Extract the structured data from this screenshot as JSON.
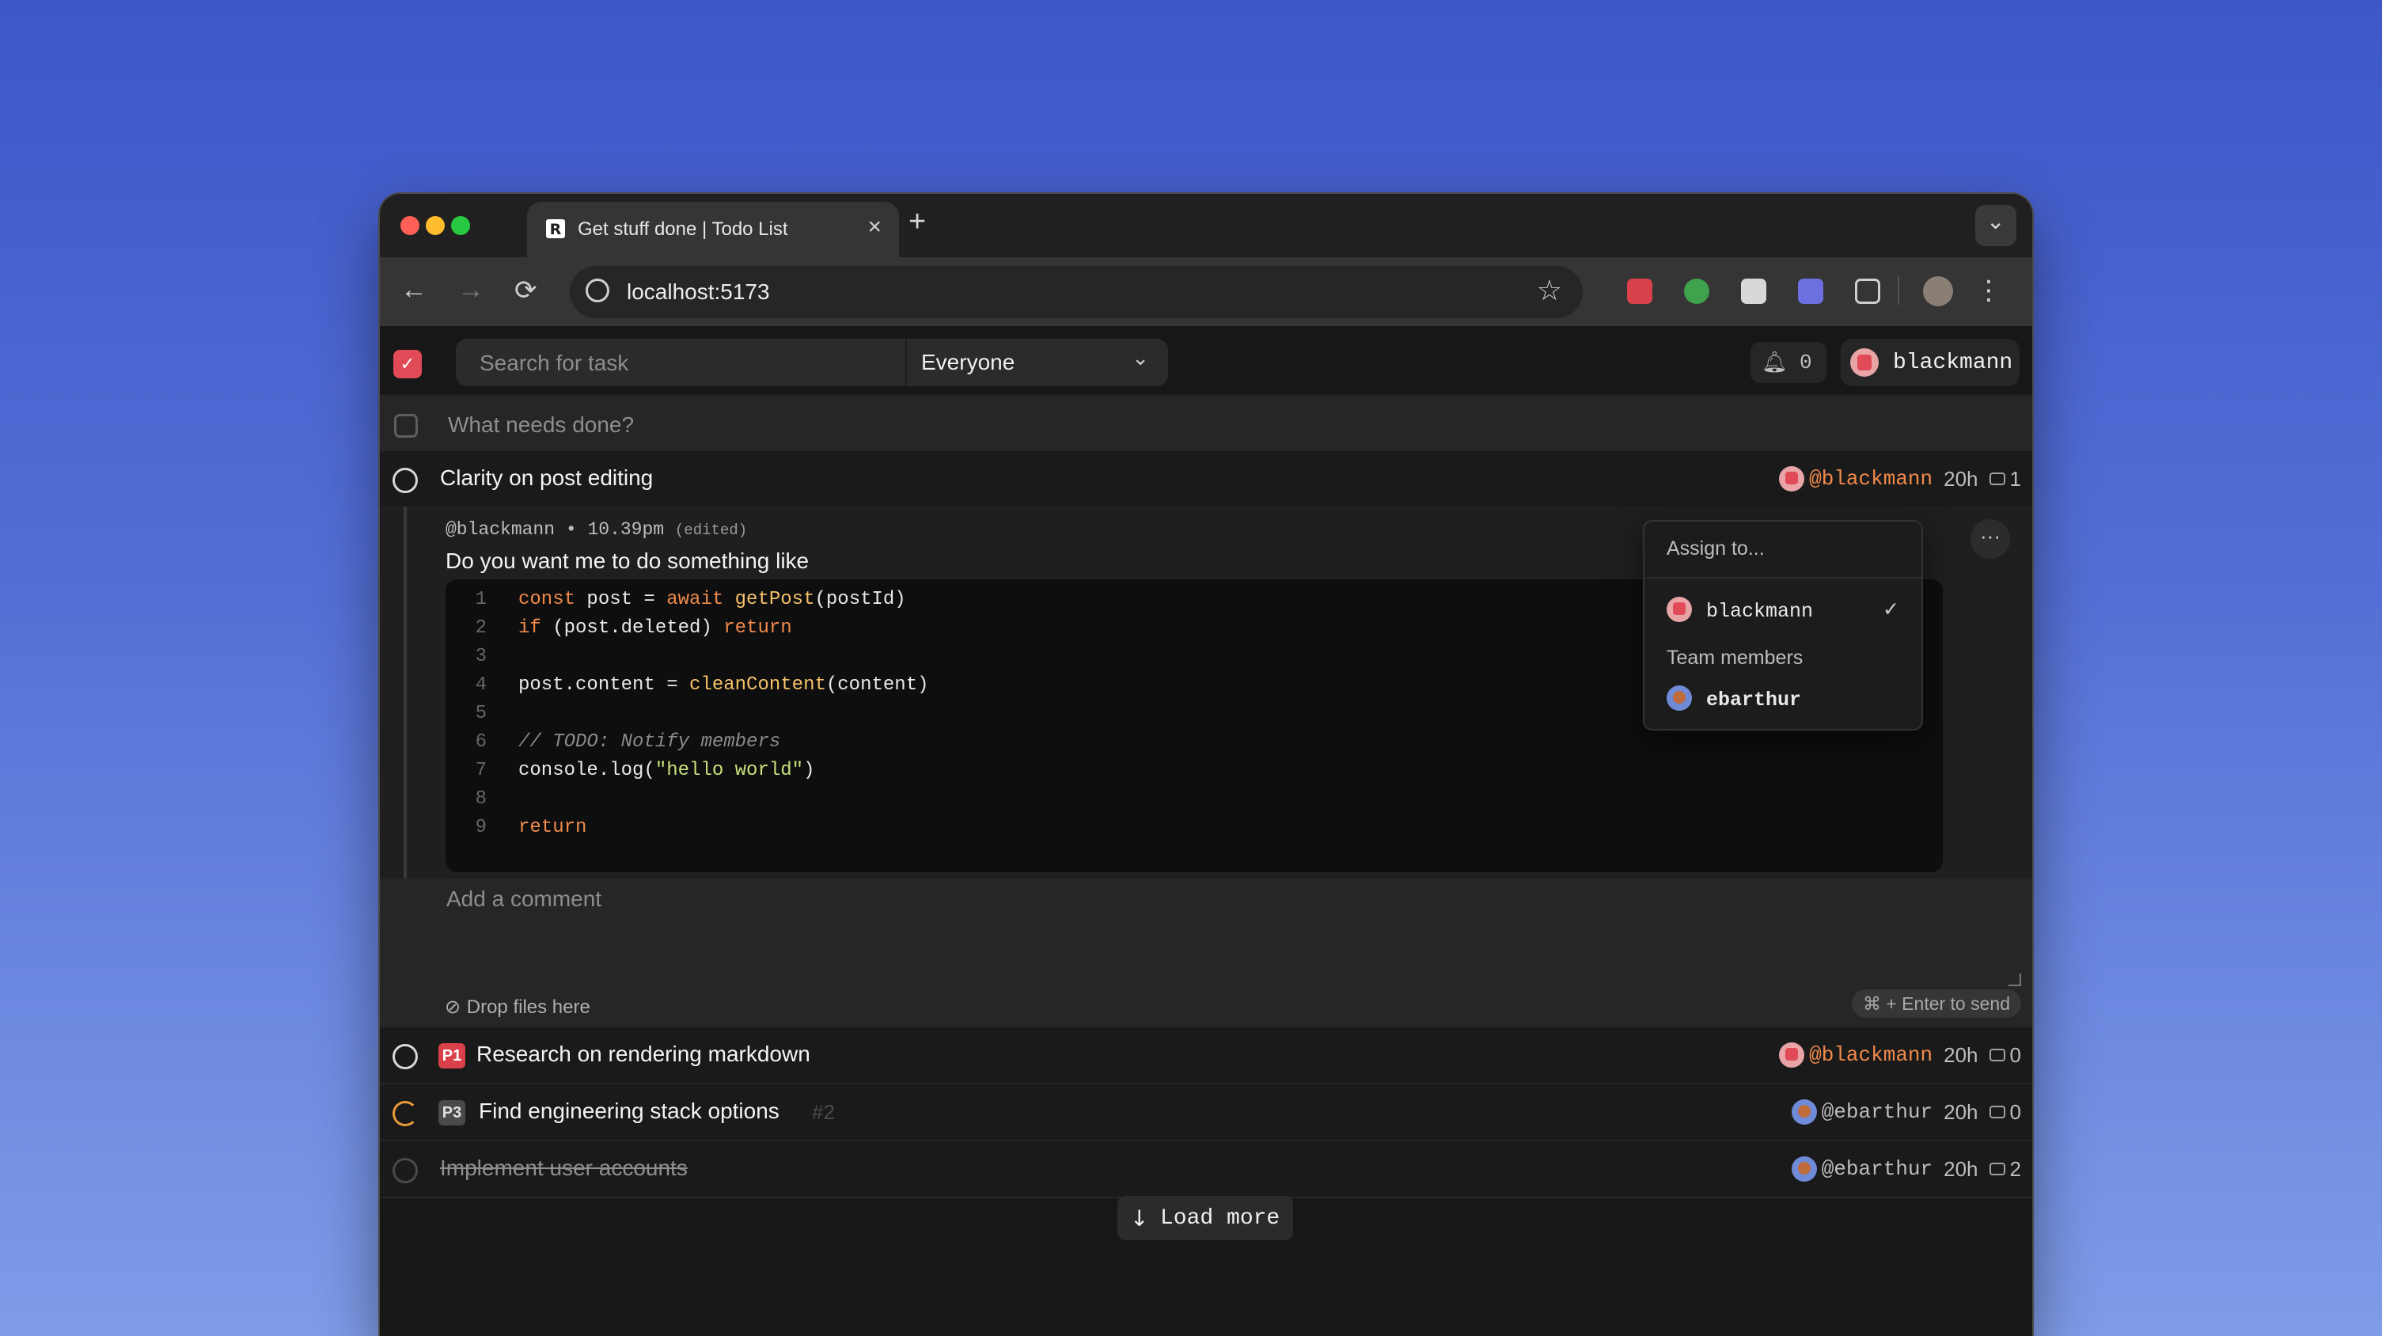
{
  "browser": {
    "tab_title": "Get stuff done | Todo List",
    "tab_close": "×",
    "new_tab": "+",
    "url": "localhost:5173",
    "back": "←",
    "forward": "→",
    "reload": "⟳",
    "bookmark": "☆",
    "menu": "⋮",
    "tab_menu": "⌄"
  },
  "app": {
    "search_placeholder": "Search for task",
    "filter_value": "Everyone",
    "filter_chevron": "⌄",
    "notification_count": "0",
    "current_user": "blackmann",
    "new_task_placeholder": "What needs done?",
    "load_more": "Load more",
    "load_more_arrow": "↓"
  },
  "tasks": [
    {
      "title": "Clarity on post editing",
      "assignee": "@blackmann",
      "time": "20h",
      "comments": "1",
      "status": "open",
      "priority": ""
    },
    {
      "title": "Research on rendering markdown",
      "assignee": "@blackmann",
      "time": "20h",
      "comments": "0",
      "status": "open",
      "priority": "P1"
    },
    {
      "title": "Find engineering stack options",
      "number": "#2",
      "assignee": "@ebarthur",
      "time": "20h",
      "comments": "0",
      "status": "in-progress",
      "priority": "P3"
    },
    {
      "title": "Implement user accounts",
      "assignee": "@ebarthur",
      "time": "20h",
      "comments": "2",
      "status": "done",
      "priority": ""
    }
  ],
  "comment": {
    "author": "@blackmann",
    "separator": "•",
    "time": "10.39pm",
    "edited": "(edited)",
    "text": "Do you want me to do something like",
    "more": "···",
    "code_lines": [
      {
        "n": "1",
        "text": "const post = await getPost(postId)"
      },
      {
        "n": "2",
        "text": "if (post.deleted) return"
      },
      {
        "n": "3",
        "text": ""
      },
      {
        "n": "4",
        "text": "post.content = cleanContent(content)"
      },
      {
        "n": "5",
        "text": ""
      },
      {
        "n": "6",
        "text": "// TODO: Notify members"
      },
      {
        "n": "7",
        "text": "console.log(\"hello world\")"
      },
      {
        "n": "8",
        "text": ""
      },
      {
        "n": "9",
        "text": "return"
      }
    ],
    "add_placeholder": "Add a comment",
    "drop_files": "Drop files here",
    "send_hint": "⌘ + Enter to send"
  },
  "assign_menu": {
    "heading": "Assign to...",
    "current": "blackmann",
    "check": "✓",
    "section": "Team members",
    "members": [
      "ebarthur"
    ]
  },
  "colors": {
    "accent": "#e14b57",
    "assignee_highlight": "#f08a4b",
    "in_progress": "#e89a3c"
  }
}
